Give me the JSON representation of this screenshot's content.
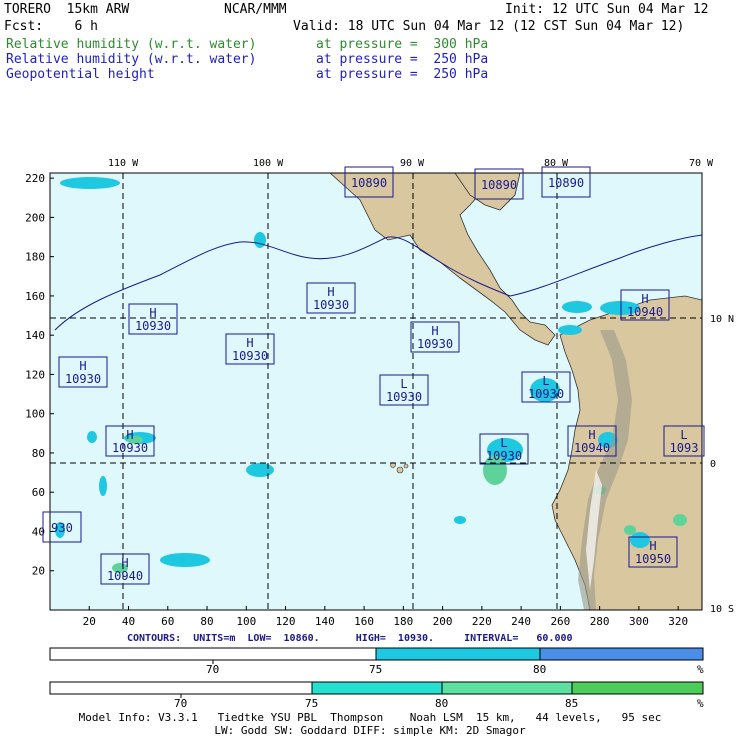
{
  "header": {
    "model": "TORERO  15km ARW",
    "org": "NCAR/MMM",
    "init": "Init: 12 UTC Sun 04 Mar 12",
    "fcst": "Fcst:    6 h",
    "valid": "Valid: 18 UTC Sun 04 Mar 12 (12 CST Sun 04 Mar 12)",
    "fields": [
      {
        "name": "Relative humidity (w.r.t. water)",
        "level": "at pressure =  300 hPa",
        "color": "#2e8b2e"
      },
      {
        "name": "Relative humidity (w.r.t. water)",
        "level": "at pressure =  250 hPa",
        "color": "#1f1fbf"
      },
      {
        "name": "Geopotential height",
        "level": "at pressure =  250 hPa",
        "color": "#1f1fbf"
      }
    ]
  },
  "map": {
    "lon_labels": [
      "110 W",
      "100 W",
      "90 W",
      "80 W",
      "70 W"
    ],
    "lat_labels": [
      "10 N",
      "0",
      "10 S"
    ],
    "x_ticks": [
      "20",
      "40",
      "60",
      "80",
      "100",
      "120",
      "140",
      "160",
      "180",
      "200",
      "220",
      "240",
      "260",
      "280",
      "300",
      "320"
    ],
    "y_ticks": [
      "20",
      "40",
      "60",
      "80",
      "100",
      "120",
      "140",
      "160",
      "180",
      "200",
      "220"
    ],
    "colors": {
      "ocean": "#dff8fb",
      "land": "#d9c7a0",
      "rh_blue": "#1ec8e0",
      "rh_green": "#5dd39a",
      "contour": "#1a1a8c"
    },
    "pressure_centers": [
      {
        "type": "H",
        "value": "10930"
      },
      {
        "type": "H",
        "value": "10930"
      },
      {
        "type": "H",
        "value": "10930"
      },
      {
        "type": "H",
        "value": "10930"
      },
      {
        "type": "H",
        "value": "10930"
      },
      {
        "type": "H",
        "value": "10930"
      },
      {
        "type": "H",
        "value": "10940"
      },
      {
        "type": "H",
        "value": "10940"
      },
      {
        "type": "H",
        "value": "10940"
      },
      {
        "type": "H",
        "value": "10950"
      },
      {
        "type": "L",
        "value": "10930"
      },
      {
        "type": "L",
        "value": "10930"
      },
      {
        "type": "L",
        "value": "10930"
      },
      {
        "type": "L",
        "value": "1093"
      },
      {
        "type": "",
        "value": "10890"
      },
      {
        "type": "",
        "value": "10890"
      },
      {
        "type": "",
        "value": "10890"
      },
      {
        "type": "",
        "value": "930"
      }
    ]
  },
  "contours_info": "CONTOURS:  UNITS=m  LOW=  10860.      HIGH=  10930.     INTERVAL=   60.000",
  "colorbars": [
    {
      "labels": [
        "70",
        "75",
        "80"
      ],
      "unit": "%",
      "segments": [
        "#ffffff",
        "#1ec8e0",
        "#4a8ee8"
      ]
    },
    {
      "labels": [
        "70",
        "75",
        "80",
        "85"
      ],
      "unit": "%",
      "segments": [
        "#ffffff",
        "#26e0cf",
        "#5de0a0",
        "#4ccc5a"
      ]
    }
  ],
  "footer": {
    "line1": "Model Info: V3.3.1   Tiedtke YSU PBL  Thompson    Noah LSM  15 km,   44 levels,   95 sec",
    "line2": "LW: Godd SW: Goddard DIFF: simple KM: 2D Smagor"
  }
}
